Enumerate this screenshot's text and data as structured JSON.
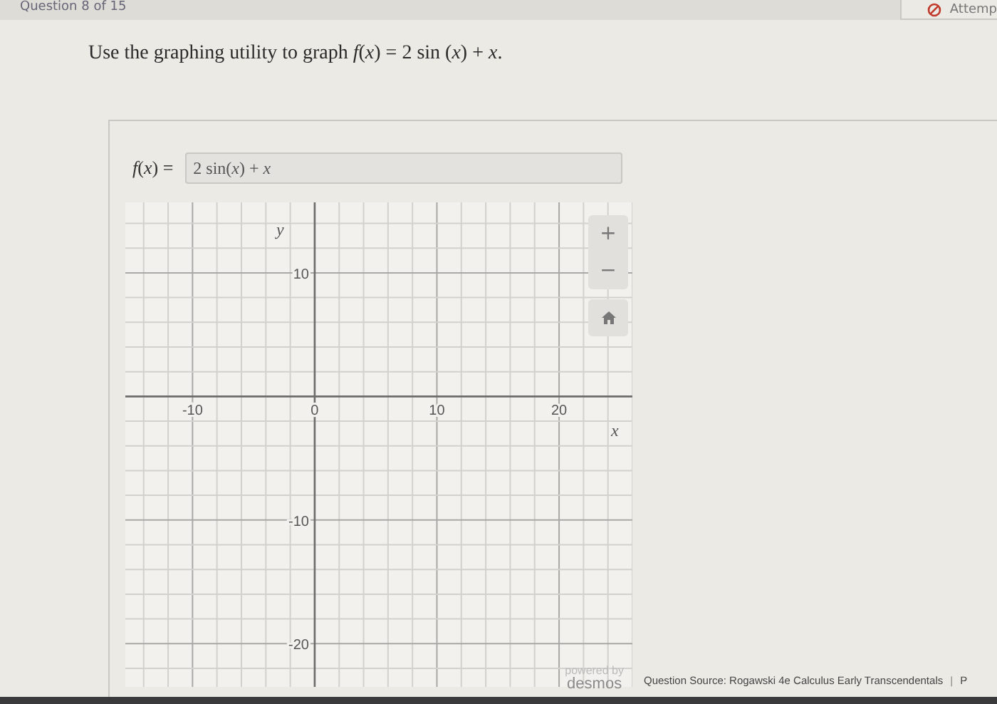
{
  "top_bar": {
    "question_counter": "Question 8 of 15",
    "attempt_button": "Attemp"
  },
  "prompt": "Use the graphing utility to graph *f*(*x*) = 2 sin (*x*) + *x*.",
  "function_input": {
    "label": "*f*(*x*) =",
    "value": "2 sin(*x*) + *x*"
  },
  "graph": {
    "zoom_in": "+",
    "zoom_out": "−",
    "powered_by": "powered by",
    "brand": "desmos",
    "chart_data": {
      "type": "line",
      "xlabel": "x",
      "ylabel": "y",
      "xlim": [
        -15.5,
        26
      ],
      "ylim": [
        -23.5,
        15.7
      ],
      "xticks": [
        -10,
        0,
        10,
        20
      ],
      "yticks": [
        -20,
        -10,
        10
      ],
      "grid": true
    }
  },
  "footer": {
    "source": "Question Source: Rogawski 4e Calculus Early Transcendentals",
    "separator": "|",
    "cut_text": "P"
  }
}
